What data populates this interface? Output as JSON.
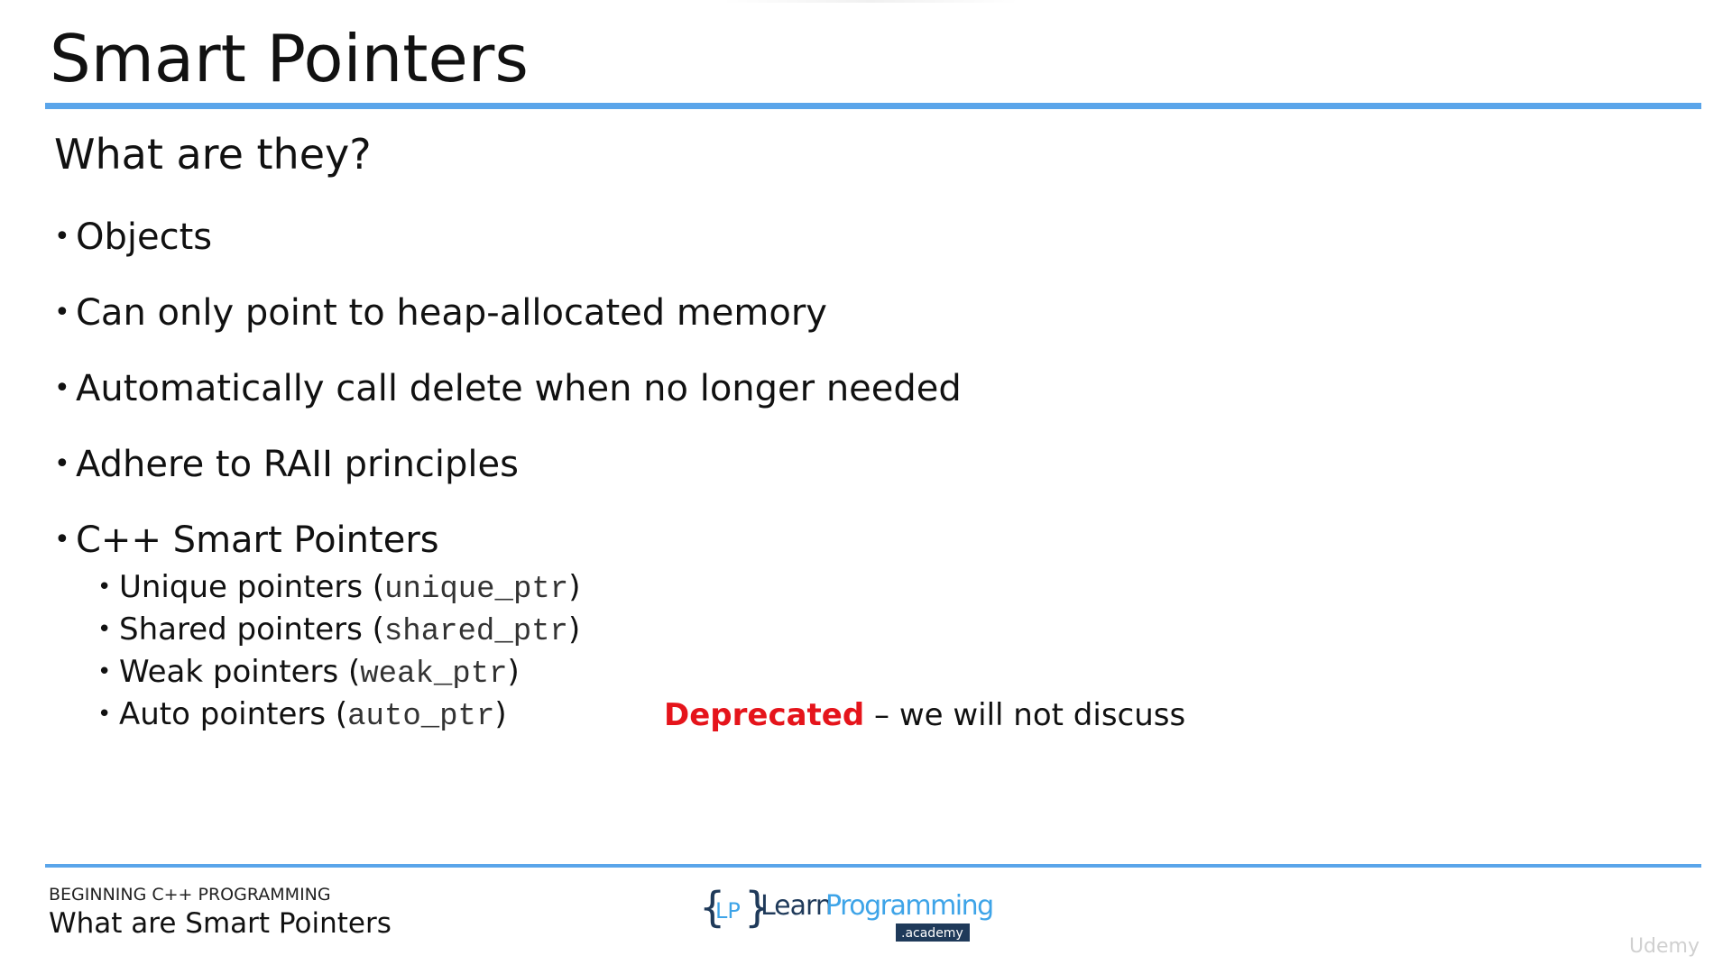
{
  "slide": {
    "title": "Smart Pointers",
    "subtitle": "What are they?",
    "bullets": [
      {
        "text": "Objects"
      },
      {
        "text": "Can only point to heap-allocated memory"
      },
      {
        "text": "Automatically call delete when no longer needed"
      },
      {
        "text": "Adhere to RAII principles"
      },
      {
        "text": "C++ Smart Pointers"
      }
    ],
    "bullet_glyph": "•",
    "sub_bullets": [
      {
        "label": "Unique pointers (",
        "code": "unique_ptr",
        "close": ")"
      },
      {
        "label": "Shared pointers (",
        "code": "shared_ptr",
        "close": ")"
      },
      {
        "label": "Weak pointers (",
        "code": "weak_ptr",
        "close": ")"
      },
      {
        "label": "Auto pointers (",
        "code": "auto_ptr",
        "close": ")"
      }
    ],
    "note": {
      "highlight": "Deprecated",
      "rest": " – we will not discuss"
    }
  },
  "footer": {
    "course": "BEGINNING C++ PROGRAMMING",
    "lesson": "What are Smart Pointers",
    "logo": {
      "left_brace": "{",
      "initials": "LP",
      "right_brace": "}",
      "word_learn": "Learn",
      "word_programming": "Programming",
      "badge": ".academy"
    }
  },
  "watermark": "Udemy",
  "colors": {
    "accent_rule": "#5aa5ea",
    "deprecated_red": "#e5141b",
    "logo_dark": "#1f3a5a",
    "logo_blue": "#3ea4e8"
  }
}
